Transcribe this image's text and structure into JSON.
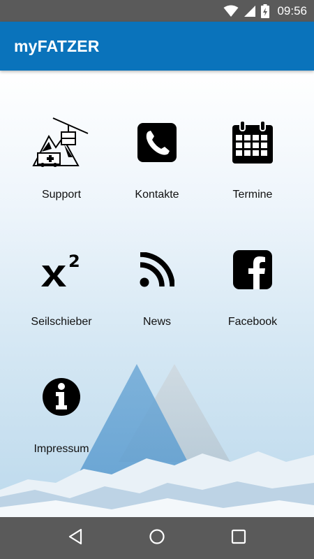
{
  "status_bar": {
    "time": "09:56",
    "icons": [
      "wifi-icon",
      "signal-icon",
      "battery-charging-icon"
    ]
  },
  "app_bar": {
    "title": "myFATZER"
  },
  "menu": {
    "items": [
      {
        "label": "Support",
        "icon": "mountain-cablecar-ambulance-icon"
      },
      {
        "label": "Kontakte",
        "icon": "phone-icon"
      },
      {
        "label": "Termine",
        "icon": "calendar-icon"
      },
      {
        "label": "Seilschieber",
        "icon": "x-squared-icon"
      },
      {
        "label": "News",
        "icon": "rss-icon"
      },
      {
        "label": "Facebook",
        "icon": "facebook-icon"
      },
      {
        "label": "Impressum",
        "icon": "info-icon"
      }
    ]
  },
  "nav_bar": {
    "buttons": [
      "back-icon",
      "home-icon",
      "recents-icon"
    ]
  },
  "colors": {
    "status_bar": "#5a5a5a",
    "app_bar": "#0a73bb",
    "nav_bar": "#5a5a5a"
  }
}
